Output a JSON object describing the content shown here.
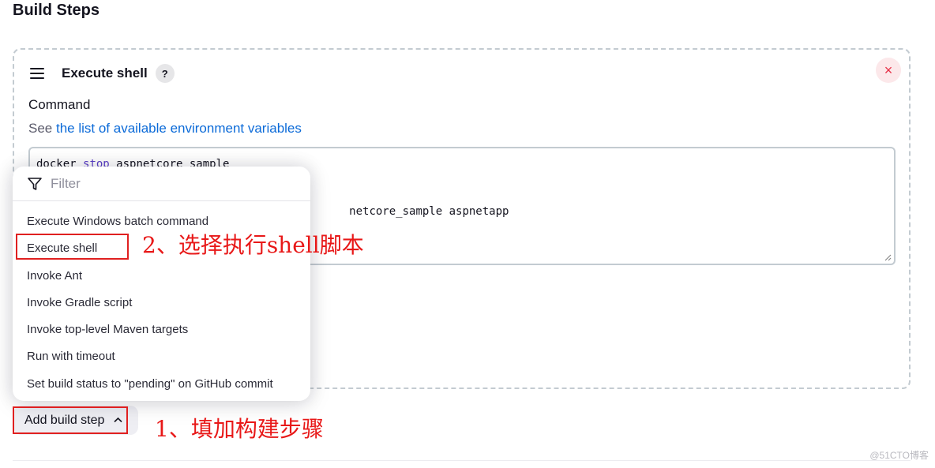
{
  "section": {
    "title": "Build Steps"
  },
  "step": {
    "title": "Execute shell",
    "help_label": "?",
    "close_label": "×"
  },
  "command": {
    "label": "Command",
    "desc_prefix": "See ",
    "desc_link": "the list of available environment variables",
    "lines": [
      {
        "pre": "docker ",
        "kw": "stop",
        "post": " aspnetcore_sample"
      },
      {
        "pre": "",
        "kw": "",
        "post": ""
      },
      {
        "pre": "",
        "kw": "",
        "post": ""
      },
      {
        "pre": "                                               ",
        "kw": "",
        "post": "netcore_sample aspnetapp"
      }
    ]
  },
  "dropdown": {
    "filter_placeholder": "Filter",
    "items": [
      "Execute Windows batch command",
      "Execute shell",
      "Invoke Ant",
      "Invoke Gradle script",
      "Invoke top-level Maven targets",
      "Run with timeout",
      "Set build status to \"pending\" on GitHub commit"
    ]
  },
  "add_step": {
    "label": "Add build step",
    "chevron": "^"
  },
  "annotations": {
    "step1": "1、填加构建步骤",
    "step2": "2、选择执行shell脚本",
    "color": "#e81818"
  },
  "watermark": "@51CTO博客"
}
